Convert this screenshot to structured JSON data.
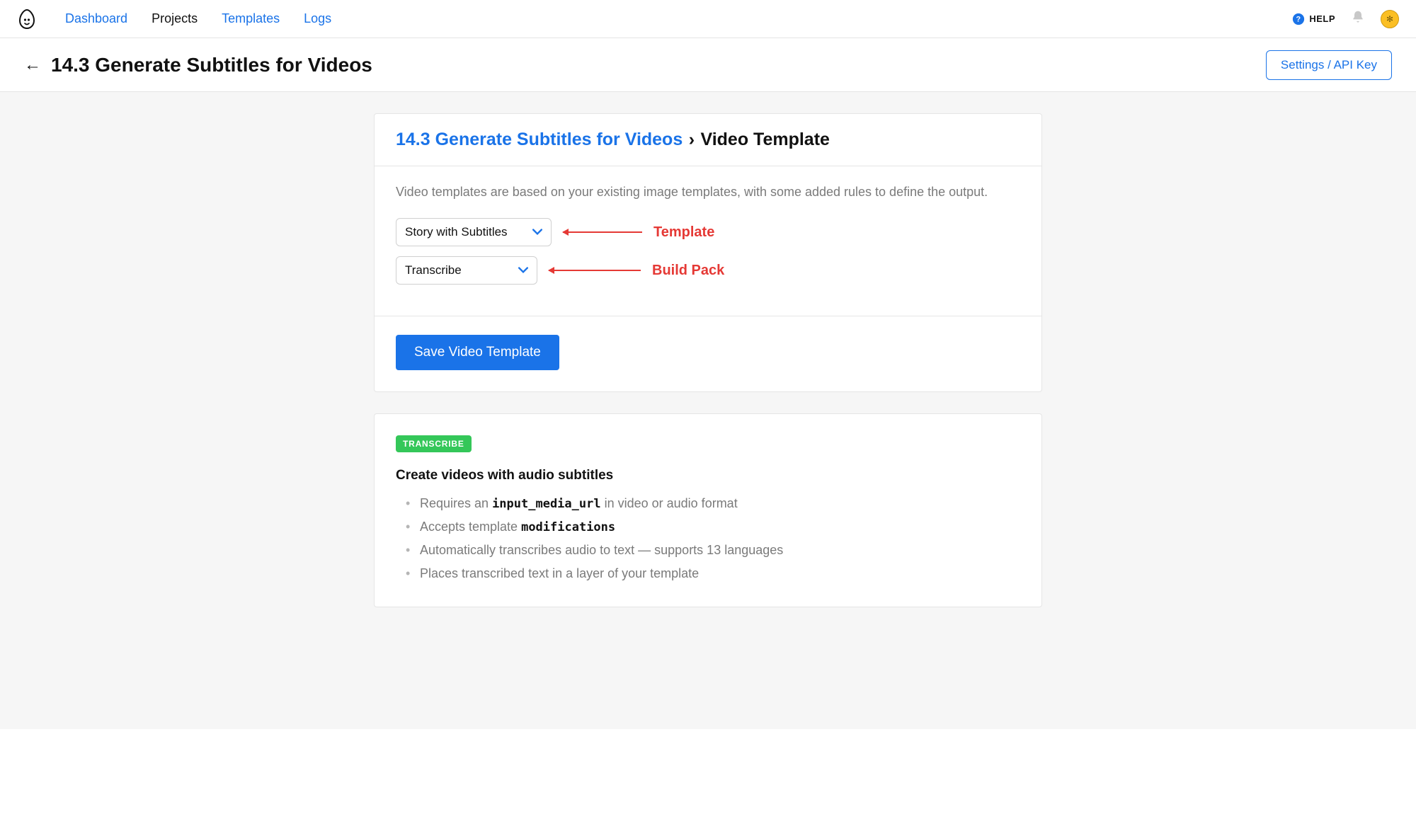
{
  "nav": {
    "items": [
      {
        "label": "Dashboard",
        "active": false
      },
      {
        "label": "Projects",
        "active": true
      },
      {
        "label": "Templates",
        "active": false
      },
      {
        "label": "Logs",
        "active": false
      }
    ],
    "help_label": "HELP",
    "avatar_glyph": "✻"
  },
  "page": {
    "title": "14.3 Generate Subtitles for Videos",
    "settings_button": "Settings / API Key"
  },
  "breadcrumb": {
    "link": "14.3 Generate Subtitles for Videos",
    "sep": "›",
    "current": "Video Template"
  },
  "form": {
    "description": "Video templates are based on your existing image templates, with some added rules to define the output.",
    "template_select": {
      "value": "Story with Subtitles"
    },
    "buildpack_select": {
      "value": "Transcribe"
    },
    "annote_template": "Template",
    "annote_buildpack": "Build Pack",
    "save_label": "Save Video Template"
  },
  "transcribe": {
    "badge": "TRANSCRIBE",
    "heading": "Create videos with audio subtitles",
    "bullets": [
      {
        "pre": "Requires an ",
        "code": "input_media_url",
        "post": " in video or audio format"
      },
      {
        "pre": "Accepts template ",
        "code": "modifications",
        "post": ""
      },
      {
        "pre": "Automatically transcribes audio to text — supports 13 languages",
        "code": "",
        "post": ""
      },
      {
        "pre": "Places transcribed text in a layer of your template",
        "code": "",
        "post": ""
      }
    ]
  }
}
